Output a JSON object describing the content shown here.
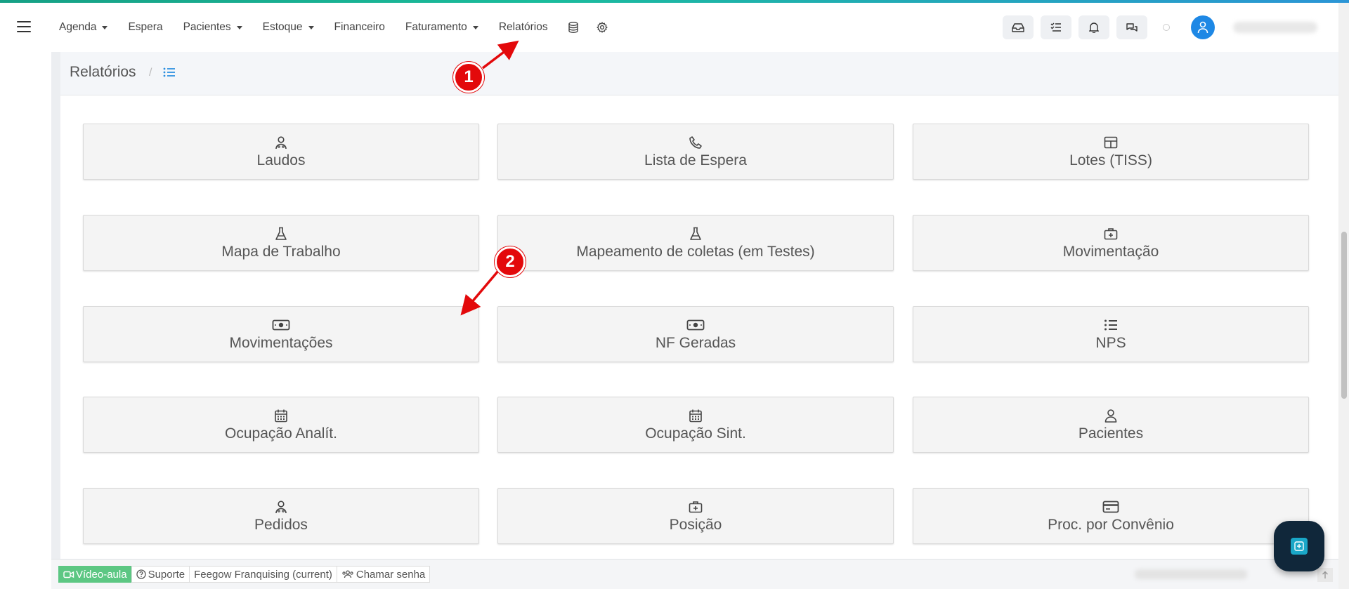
{
  "nav": {
    "items": [
      {
        "label": "Agenda",
        "dropdown": true
      },
      {
        "label": "Espera",
        "dropdown": false
      },
      {
        "label": "Pacientes",
        "dropdown": true
      },
      {
        "label": "Estoque",
        "dropdown": true
      },
      {
        "label": "Financeiro",
        "dropdown": false
      },
      {
        "label": "Faturamento",
        "dropdown": true
      },
      {
        "label": "Relatórios",
        "dropdown": false
      }
    ],
    "icons": [
      "database-icon",
      "gear-icon"
    ],
    "tools": [
      "inbox-icon",
      "checklist-icon",
      "bell-icon",
      "chat-icon"
    ],
    "avatar_icon": "user-icon"
  },
  "breadcrumb": {
    "title": "Relatórios",
    "separator": "/",
    "icon": "list-icon"
  },
  "reports": [
    {
      "label": "Laudos",
      "icon": "doctor-icon"
    },
    {
      "label": "Lista de Espera",
      "icon": "phone-icon"
    },
    {
      "label": "Lotes (TISS)",
      "icon": "table-icon"
    },
    {
      "label": "Mapa de Trabalho",
      "icon": "flask-icon"
    },
    {
      "label": "Mapeamento de coletas (em Testes)",
      "icon": "flask-icon"
    },
    {
      "label": "Movimentação",
      "icon": "medical-kit-icon"
    },
    {
      "label": "Movimentações",
      "icon": "money-icon"
    },
    {
      "label": "NF Geradas",
      "icon": "money-icon"
    },
    {
      "label": "NPS",
      "icon": "list-icon"
    },
    {
      "label": "Ocupação Analít.",
      "icon": "calendar-icon"
    },
    {
      "label": "Ocupação Sint.",
      "icon": "calendar-icon"
    },
    {
      "label": "Pacientes",
      "icon": "user-icon"
    },
    {
      "label": "Pedidos",
      "icon": "doctor-icon"
    },
    {
      "label": "Posição",
      "icon": "medical-kit-icon"
    },
    {
      "label": "Proc. por Convênio",
      "icon": "credit-card-icon"
    }
  ],
  "footer": {
    "video": "Vídeo-aula",
    "support": "Suporte",
    "franchise": "Feegow Franquising (current)",
    "call": "Chamar senha"
  },
  "annotations": [
    {
      "number": "1",
      "color": "#e3090b"
    },
    {
      "number": "2",
      "color": "#e3090b"
    }
  ]
}
